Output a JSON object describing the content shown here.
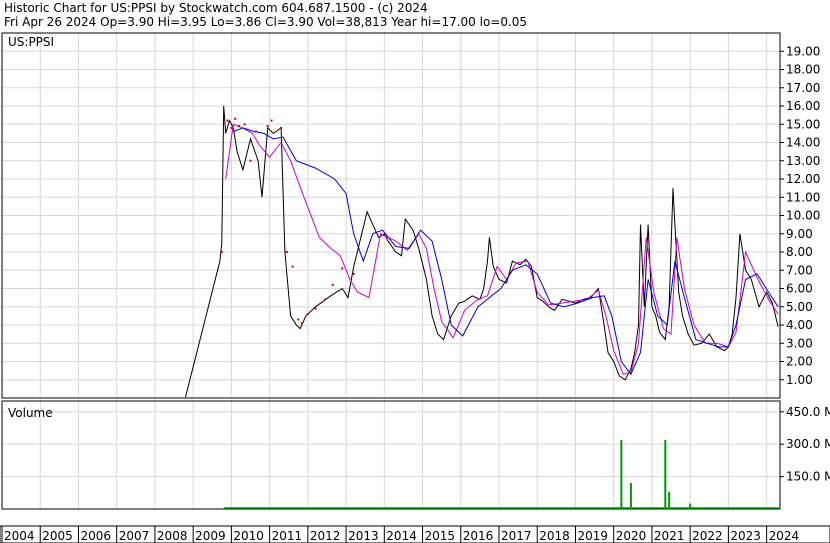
{
  "header": {
    "line1": "Historic Chart for US:PPSI by Stockwatch.com 604.687.1500 - (c) 2024",
    "line2": "Fri Apr 26 2024  Op=3.90  Hi=3.95  Lo=3.86  Cl=3.90  Vol=38,813  Year hi=17.00  lo=0.05"
  },
  "colors": {
    "price": "#000000",
    "close_marker": "#cc0000",
    "ma_short": "#cc00cc",
    "ma_long": "#0000cc",
    "volume": "#009900",
    "grid": "#d8d8d8",
    "border": "#000000"
  },
  "chart_data": [
    {
      "type": "line",
      "panel": "price",
      "label": "US:PPSI",
      "ylim": [
        0,
        20
      ],
      "xlim": [
        2004,
        2024.35
      ],
      "y_ticks": [
        "1.00",
        "2.00",
        "3.00",
        "4.00",
        "5.00",
        "6.00",
        "7.00",
        "8.00",
        "9.00",
        "10.00",
        "11.00",
        "12.00",
        "13.00",
        "14.00",
        "15.00",
        "16.00",
        "17.00",
        "18.00",
        "19.00"
      ],
      "x_ticks": [
        "2004",
        "2005",
        "2006",
        "2007",
        "2008",
        "2009",
        "2010",
        "2011",
        "2012",
        "2013",
        "2014",
        "2015",
        "2016",
        "2017",
        "2018",
        "2019",
        "2020",
        "2021",
        "2022",
        "2023",
        "2024"
      ],
      "series": [
        {
          "role": "price",
          "x": [
            2008.8,
            2009.7,
            2009.75,
            2009.8,
            2009.85,
            2009.95,
            2010.05,
            2010.15,
            2010.3,
            2010.5,
            2010.7,
            2010.8,
            2010.95,
            2011.1,
            2011.3,
            2011.4,
            2011.55,
            2011.7,
            2011.8,
            2011.95,
            2012.2,
            2012.4,
            2012.6,
            2012.75,
            2012.9,
            2013.05,
            2013.2,
            2013.35,
            2013.55,
            2013.7,
            2013.85,
            2014.0,
            2014.1,
            2014.3,
            2014.45,
            2014.55,
            2014.75,
            2014.9,
            2015.1,
            2015.25,
            2015.4,
            2015.55,
            2015.75,
            2015.95,
            2016.1,
            2016.3,
            2016.5,
            2016.6,
            2016.7,
            2016.75,
            2016.85,
            2017.0,
            2017.2,
            2017.35,
            2017.55,
            2017.7,
            2017.85,
            2018.0,
            2018.15,
            2018.3,
            2018.45,
            2018.65,
            2018.85,
            2019.0,
            2019.2,
            2019.4,
            2019.6,
            2019.75,
            2019.85,
            2020.0,
            2020.15,
            2020.3,
            2020.45,
            2020.55,
            2020.65,
            2020.7,
            2020.8,
            2020.9,
            2021.0,
            2021.1,
            2021.2,
            2021.35,
            2021.45,
            2021.55,
            2021.6,
            2021.7,
            2021.8,
            2021.95,
            2022.1,
            2022.3,
            2022.5,
            2022.7,
            2022.9,
            2023.0,
            2023.1,
            2023.2,
            2023.3,
            2023.45,
            2023.6,
            2023.8,
            2024.0,
            2024.15,
            2024.3
          ],
          "y": [
            0.05,
            7.5,
            8.5,
            16.0,
            14.5,
            15.2,
            14.8,
            13.5,
            12.5,
            14.2,
            13.0,
            11.0,
            14.8,
            14.5,
            14.8,
            8.0,
            4.5,
            4.0,
            3.8,
            4.5,
            5.0,
            5.3,
            5.6,
            5.8,
            6.0,
            5.5,
            7.2,
            8.5,
            10.2,
            9.5,
            8.8,
            9.0,
            8.6,
            8.0,
            7.8,
            9.8,
            9.2,
            8.2,
            6.5,
            4.5,
            3.5,
            3.2,
            4.5,
            5.2,
            5.3,
            5.6,
            5.4,
            6.0,
            7.5,
            8.8,
            7.2,
            6.5,
            6.3,
            7.5,
            7.3,
            7.6,
            7.2,
            5.5,
            5.3,
            5.0,
            4.8,
            5.4,
            5.3,
            5.2,
            5.4,
            5.5,
            6.0,
            4.0,
            2.5,
            2.0,
            1.2,
            1.0,
            1.6,
            2.5,
            4.0,
            9.5,
            5.0,
            9.5,
            5.0,
            4.5,
            3.6,
            3.2,
            5.0,
            11.5,
            9.5,
            5.8,
            4.5,
            3.5,
            2.9,
            3.0,
            3.5,
            2.8,
            2.6,
            2.8,
            3.5,
            5.5,
            9.0,
            7.0,
            6.5,
            5.0,
            5.8,
            5.2,
            3.9
          ]
        },
        {
          "role": "ma_short",
          "x": [
            2009.85,
            2010.05,
            2010.3,
            2010.55,
            2010.75,
            2011.0,
            2011.3,
            2011.55,
            2011.9,
            2012.3,
            2012.6,
            2012.85,
            2013.1,
            2013.3,
            2013.6,
            2013.9,
            2014.3,
            2014.6,
            2014.9,
            2015.1,
            2015.3,
            2015.5,
            2015.8,
            2016.1,
            2016.45,
            2016.7,
            2016.95,
            2017.2,
            2017.45,
            2017.75,
            2018.0,
            2018.3,
            2018.65,
            2018.95,
            2019.3,
            2019.6,
            2019.8,
            2020.0,
            2020.25,
            2020.45,
            2020.65,
            2020.85,
            2021.05,
            2021.3,
            2021.5,
            2021.65,
            2021.85,
            2022.1,
            2022.4,
            2022.7,
            2023.0,
            2023.2,
            2023.45,
            2023.75,
            2024.05,
            2024.3
          ],
          "y": [
            12.0,
            15.0,
            14.8,
            14.5,
            13.8,
            13.2,
            14.0,
            13.0,
            11.0,
            8.8,
            8.2,
            7.8,
            6.5,
            5.8,
            5.5,
            9.0,
            8.6,
            8.1,
            9.0,
            8.2,
            6.0,
            4.2,
            3.3,
            4.8,
            5.4,
            5.6,
            7.2,
            6.5,
            7.4,
            7.5,
            5.8,
            5.1,
            5.2,
            5.3,
            5.4,
            5.9,
            4.5,
            2.6,
            1.3,
            1.4,
            3.0,
            8.8,
            5.8,
            3.8,
            3.5,
            8.8,
            6.0,
            4.0,
            3.0,
            3.0,
            2.8,
            3.6,
            8.0,
            6.6,
            5.4,
            4.6
          ]
        },
        {
          "role": "ma_long",
          "x": [
            2010.05,
            2010.3,
            2010.6,
            2010.85,
            2011.1,
            2011.35,
            2011.7,
            2012.2,
            2012.7,
            2013.0,
            2013.2,
            2013.45,
            2013.7,
            2013.95,
            2014.3,
            2014.65,
            2014.95,
            2015.25,
            2015.5,
            2015.75,
            2016.05,
            2016.45,
            2016.75,
            2017.05,
            2017.35,
            2017.7,
            2018.0,
            2018.35,
            2018.7,
            2019.05,
            2019.45,
            2019.75,
            2019.95,
            2020.2,
            2020.45,
            2020.7,
            2020.9,
            2021.15,
            2021.4,
            2021.6,
            2021.85,
            2022.15,
            2022.45,
            2022.75,
            2023.0,
            2023.2,
            2023.45,
            2023.75,
            2024.05,
            2024.3
          ],
          "y": [
            14.6,
            14.8,
            14.6,
            14.5,
            14.2,
            14.3,
            13.0,
            12.6,
            12.0,
            11.2,
            9.0,
            7.5,
            9.0,
            9.2,
            8.3,
            8.2,
            9.2,
            8.6,
            6.5,
            4.0,
            3.4,
            5.0,
            5.5,
            6.0,
            7.0,
            7.3,
            6.8,
            5.2,
            5.0,
            5.2,
            5.5,
            5.6,
            4.5,
            2.0,
            1.3,
            2.5,
            6.5,
            4.5,
            4.0,
            7.5,
            5.5,
            3.2,
            3.0,
            2.8,
            2.8,
            4.0,
            6.5,
            6.8,
            5.8,
            5.0
          ]
        }
      ],
      "close_markers": {
        "x": [
          2009.75,
          2009.9,
          2010.0,
          2010.1,
          2010.2,
          2010.35,
          2010.5,
          2010.65,
          2010.95,
          2011.05,
          2011.3,
          2011.45,
          2011.6,
          2011.75,
          2011.85,
          2012.0,
          2012.2,
          2012.45,
          2012.65,
          2012.9,
          2013.2
        ],
        "y": [
          8.0,
          15.2,
          14.8,
          15.3,
          14.9,
          15.0,
          13.0,
          14.6,
          14.9,
          15.2,
          14.8,
          8.0,
          7.2,
          4.3,
          4.1,
          4.6,
          4.9,
          5.4,
          6.2,
          7.1,
          6.8
        ]
      }
    },
    {
      "type": "bar",
      "panel": "volume",
      "label": "Volume",
      "ylim": [
        0,
        500
      ],
      "y_ticks": [
        "150.0 M",
        "300.0 M",
        "450.0 M"
      ],
      "x": [
        2020.2,
        2020.45,
        2021.35,
        2021.45,
        2022.0
      ],
      "values": [
        320,
        120,
        320,
        80,
        25
      ]
    }
  ]
}
